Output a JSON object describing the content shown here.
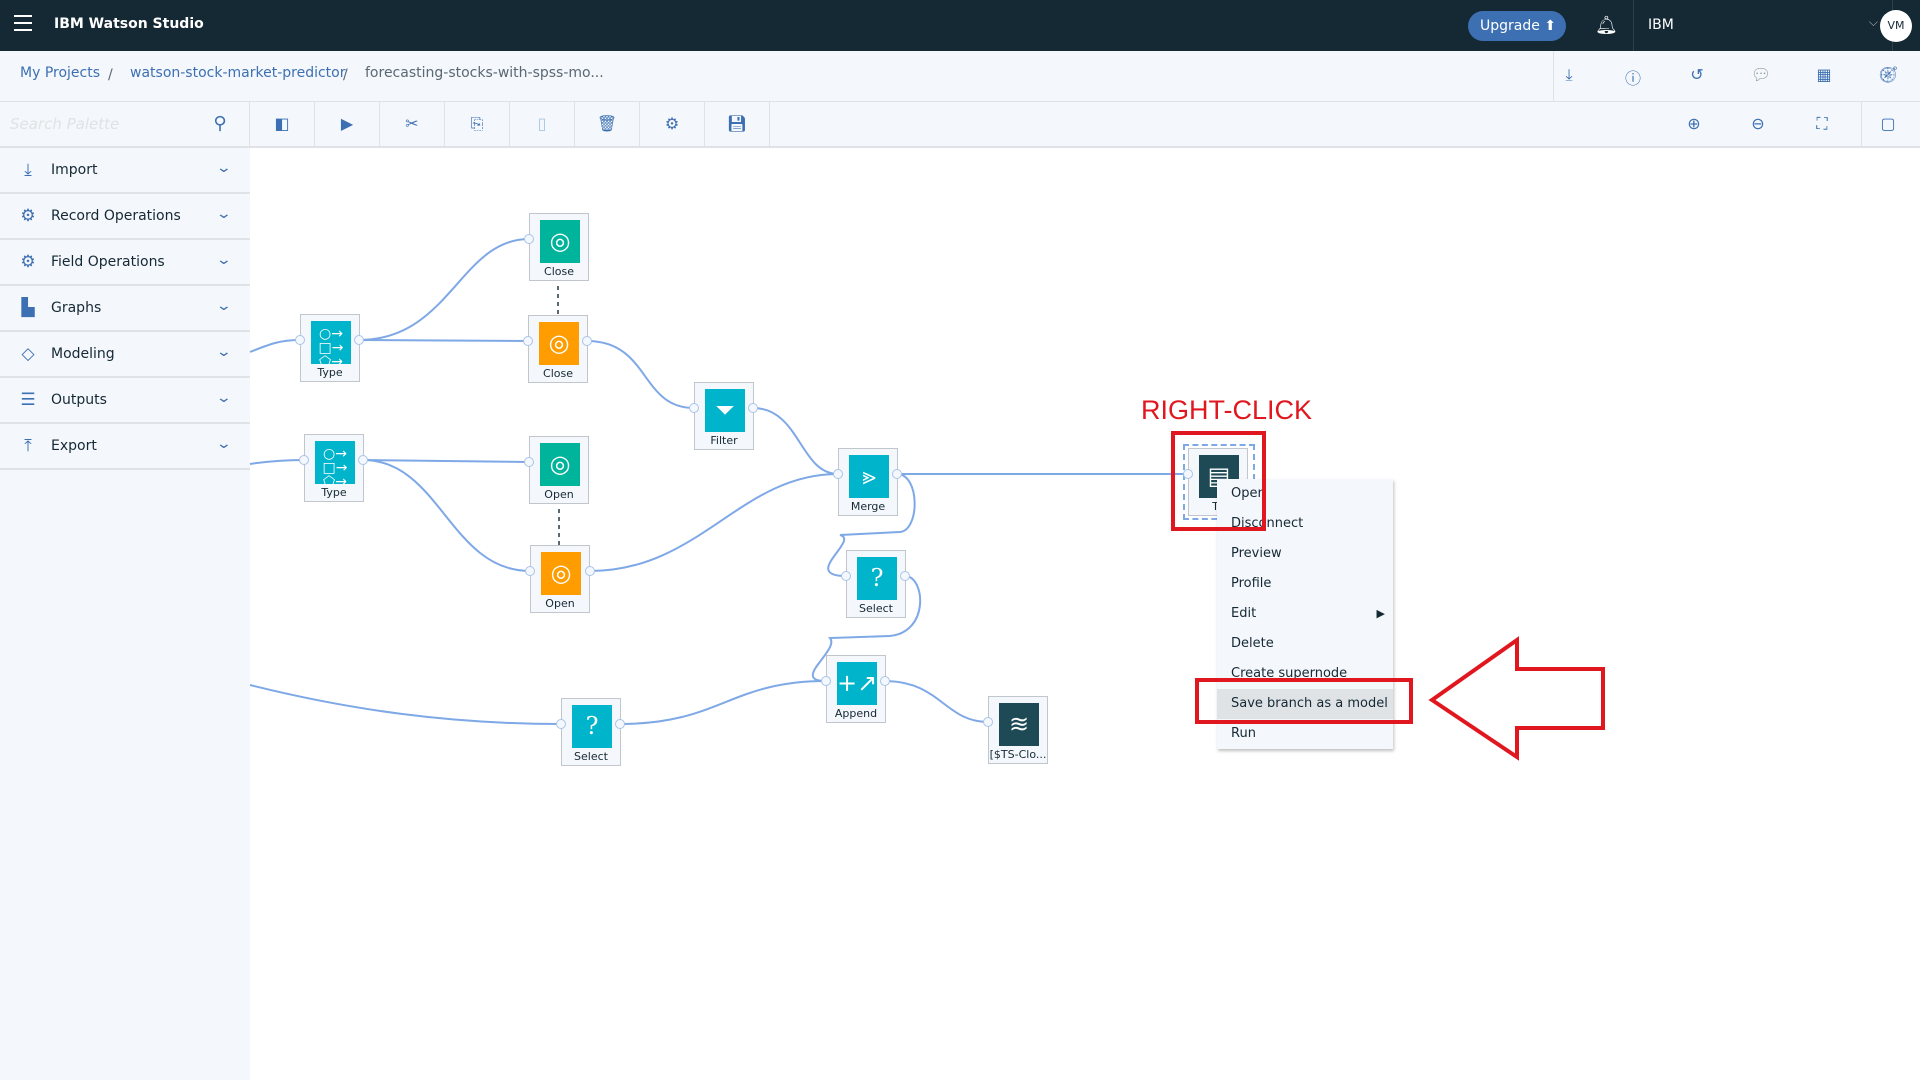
{
  "header": {
    "title": "IBM Watson Studio",
    "upgrade_label": "Upgrade",
    "account": "IBM",
    "avatar_initials": "VM"
  },
  "breadcrumb": [
    "My Projects",
    "watson-stock-market-predictor",
    "forecasting-stocks-with-spss-mo..."
  ],
  "toolbar": {
    "search_placeholder": "Search Palette"
  },
  "sidebar": {
    "items": [
      {
        "label": "Import",
        "icon": "import-icon"
      },
      {
        "label": "Record Operations",
        "icon": "record-operations-icon"
      },
      {
        "label": "Field Operations",
        "icon": "field-operations-icon"
      },
      {
        "label": "Graphs",
        "icon": "graphs-icon"
      },
      {
        "label": "Modeling",
        "icon": "modeling-icon"
      },
      {
        "label": "Outputs",
        "icon": "outputs-icon"
      },
      {
        "label": "Export",
        "icon": "export-icon"
      }
    ]
  },
  "nodes": {
    "close_green": "Close",
    "close_orange": "Close",
    "type1": "Type",
    "type2": "Type",
    "filter": "Filter",
    "open_green": "Open",
    "open_orange": "Open",
    "merge": "Merge",
    "select1": "Select",
    "append": "Append",
    "select2": "Select",
    "ts": "[$TS-Clo...",
    "table": "Ta"
  },
  "context_menu": {
    "items": [
      "Open",
      "Disconnect",
      "Preview",
      "Profile",
      "Edit",
      "Delete",
      "Create supernode",
      "Save branch as a model",
      "Run"
    ],
    "highlighted": "Save branch as a model"
  },
  "annotation": {
    "text": "RIGHT-CLICK",
    "color": "#e0171f"
  },
  "colors": {
    "header": "#152935",
    "accent": "#3d70b2",
    "teal": "#00b4cb",
    "green": "#00b49c",
    "orange": "#ff9c00",
    "dark": "#1d4a54"
  }
}
